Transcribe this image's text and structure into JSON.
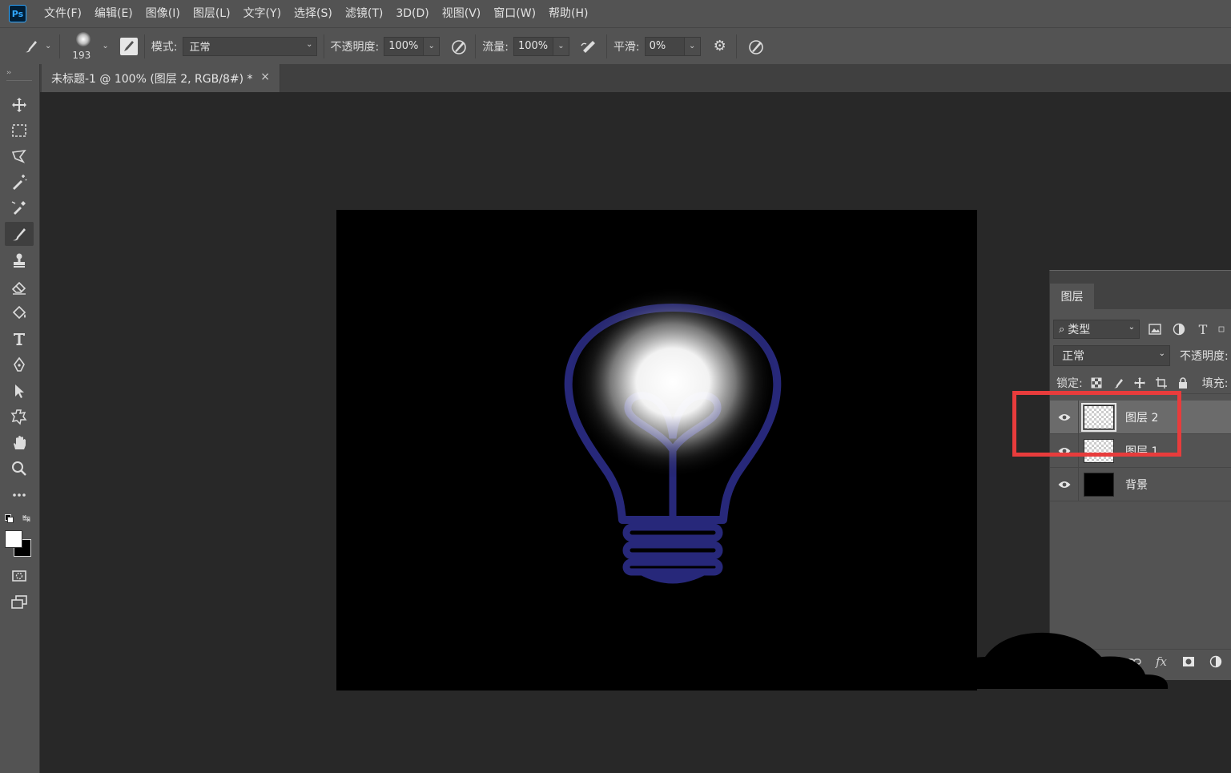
{
  "app": {
    "logo": "Ps"
  },
  "menu": [
    "文件(F)",
    "编辑(E)",
    "图像(I)",
    "图层(L)",
    "文字(Y)",
    "选择(S)",
    "滤镜(T)",
    "3D(D)",
    "视图(V)",
    "窗口(W)",
    "帮助(H)"
  ],
  "options": {
    "brush_size": "193",
    "mode_label": "模式:",
    "mode_value": "正常",
    "opacity_label": "不透明度:",
    "opacity_value": "100%",
    "flow_label": "流量:",
    "flow_value": "100%",
    "smooth_label": "平滑:",
    "smooth_value": "0%"
  },
  "document": {
    "tab_title": "未标题-1 @ 100% (图层 2, RGB/8#) *",
    "close_glyph": "×"
  },
  "tools": [
    "move-tool",
    "marquee-tool",
    "lasso-tool",
    "magic-wand-tool",
    "eyedropper-tool",
    "brush-tool",
    "stamp-tool",
    "eraser-tool",
    "paint-bucket-tool",
    "type-tool",
    "pen-tool",
    "path-selection-tool",
    "custom-shape-tool",
    "hand-tool",
    "zoom-tool",
    "more-tools",
    "quick-mask",
    "screen-mode"
  ],
  "colors": {
    "foreground": "#ffffff",
    "background": "#000000",
    "bulb_outline": "#27287a",
    "highlight": "#e83c3c"
  },
  "layers_panel": {
    "tab": "图层",
    "filter_kind": "类型",
    "blend_mode": "正常",
    "opacity_label": "不透明度:",
    "lock_label": "锁定:",
    "fill_label": "填充:",
    "layers": [
      {
        "name": "图层 2",
        "selected": true,
        "thumb": "checker"
      },
      {
        "name": "图层 1",
        "selected": false,
        "thumb": "checker"
      },
      {
        "name": "背景",
        "selected": false,
        "thumb": "black"
      }
    ],
    "footer_icons": [
      "link-icon",
      "fx-icon",
      "mask-icon",
      "adjustment-icon"
    ]
  }
}
